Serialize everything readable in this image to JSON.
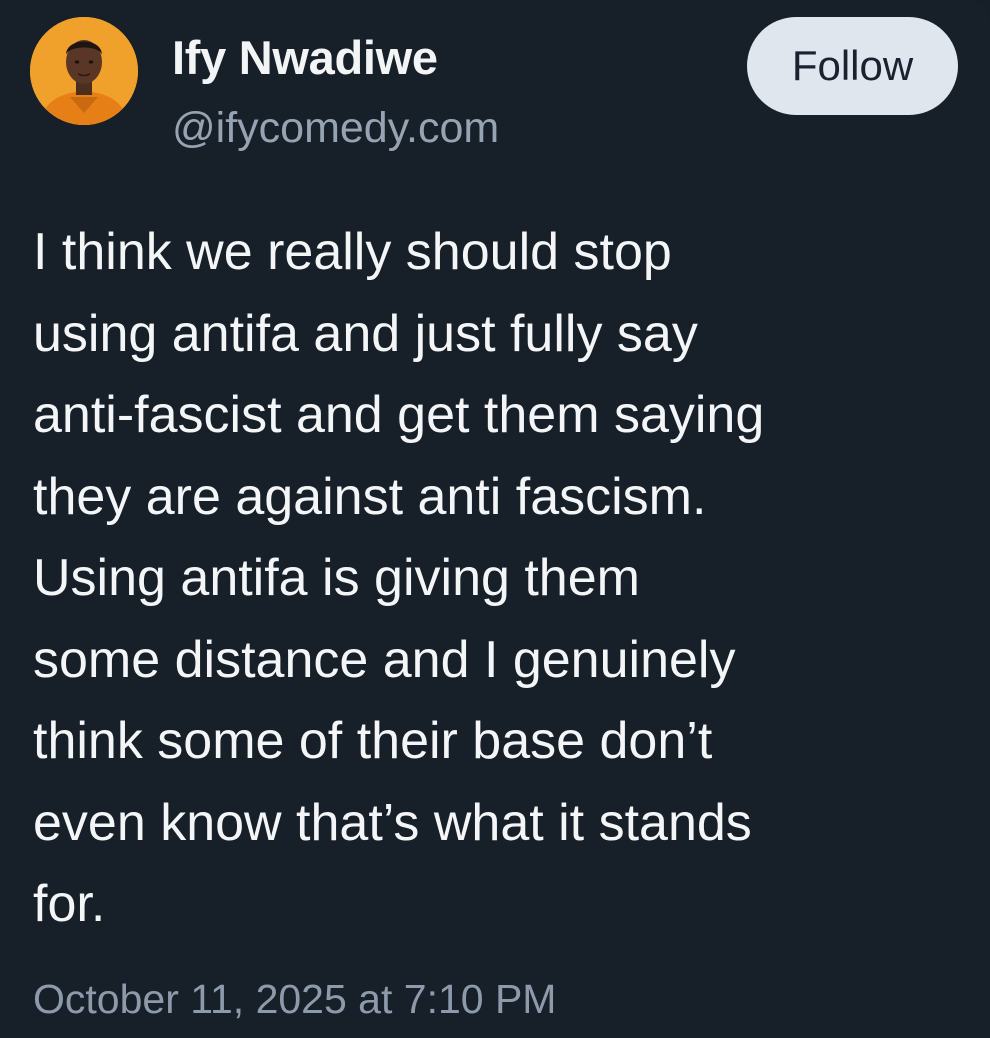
{
  "author": {
    "display_name": "Ify Nwadiwe",
    "handle": "@ifycomedy.com",
    "avatar_icon": "user-avatar"
  },
  "follow_button": {
    "label": "Follow"
  },
  "post": {
    "lines": [
      "I think we really should stop",
      "using antifa and just fully say",
      "anti-fascist and get them saying",
      "they are against anti fascism.",
      "Using antifa is giving them",
      "some distance and I genuinely",
      "think some of their base don’t",
      "even know that’s what it stands",
      "for."
    ],
    "timestamp": "October 11, 2025 at 7:10 PM"
  },
  "colors": {
    "background": "#171f28",
    "text": "#f3f5f7",
    "secondary_text": "#96a3b2",
    "follow_button_bg": "#dfe6ee",
    "avatar_bg": "#f0a12b"
  }
}
